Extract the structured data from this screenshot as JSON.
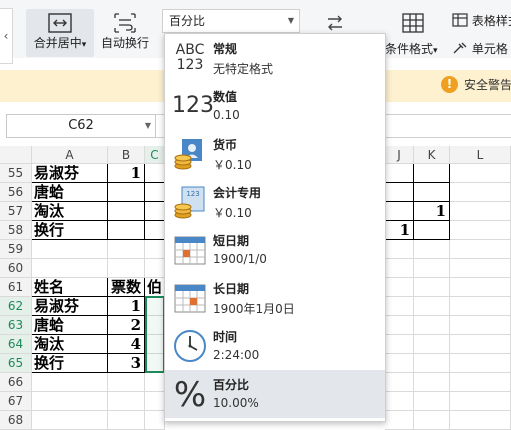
{
  "toolbar": {
    "merge_center": "合并居中",
    "merge_arrow": "▾",
    "auto_wrap": "自动换行",
    "number_format_value": "百分比",
    "cond_format": "条件格式",
    "cond_arrow": "▾",
    "table_style": "表格样式",
    "cell": "单元格"
  },
  "warning": {
    "text": "安全警告"
  },
  "name_box": {
    "value": "C62"
  },
  "columns": [
    "A",
    "B",
    "C",
    "J",
    "K",
    "L"
  ],
  "rows": [
    {
      "num": "55",
      "a": "易淑芬",
      "b": "1",
      "j": "",
      "k": ""
    },
    {
      "num": "56",
      "a": "唐蛤",
      "b": "",
      "j": "",
      "k": ""
    },
    {
      "num": "57",
      "a": "淘汰",
      "b": "",
      "j": "",
      "k": "1"
    },
    {
      "num": "58",
      "a": "换行",
      "b": "",
      "j": "1",
      "k": ""
    },
    {
      "num": "59",
      "a": "",
      "b": "",
      "j": "",
      "k": ""
    },
    {
      "num": "60",
      "a": "",
      "b": "",
      "j": "",
      "k": ""
    },
    {
      "num": "61",
      "a": "姓名",
      "b": "票数",
      "c": "伯",
      "j": "",
      "k": ""
    },
    {
      "num": "62",
      "a": "易淑芬",
      "b": "1",
      "j": "",
      "k": ""
    },
    {
      "num": "63",
      "a": "唐蛤",
      "b": "2",
      "j": "",
      "k": ""
    },
    {
      "num": "64",
      "a": "淘汰",
      "b": "4",
      "j": "",
      "k": ""
    },
    {
      "num": "65",
      "a": "换行",
      "b": "3",
      "j": "",
      "k": ""
    },
    {
      "num": "66",
      "a": "",
      "b": "",
      "j": "",
      "k": ""
    },
    {
      "num": "67",
      "a": "",
      "b": "",
      "j": "",
      "k": ""
    },
    {
      "num": "68",
      "a": "",
      "b": "",
      "j": "",
      "k": ""
    }
  ],
  "format_menu": {
    "items": [
      {
        "icon": "abc-123-icon",
        "title": "常规",
        "example": "无特定格式"
      },
      {
        "icon": "number-123-icon",
        "title": "数值",
        "example": "0.10"
      },
      {
        "icon": "currency-icon",
        "title": "货币",
        "example": "￥0.10"
      },
      {
        "icon": "accounting-icon",
        "title": "会计专用",
        "example": " ￥0.10"
      },
      {
        "icon": "short-date-icon",
        "title": "短日期",
        "example": "1900/1/0"
      },
      {
        "icon": "long-date-icon",
        "title": "长日期",
        "example": "1900年1月0日"
      },
      {
        "icon": "clock-icon",
        "title": "时间",
        "example": "2:24:00"
      },
      {
        "icon": "percent-icon",
        "title": "百分比",
        "example": "10.00%"
      }
    ],
    "icon_texts": {
      "abc": "ABC",
      "n123": "123",
      "small123": "123",
      "percent": "%"
    },
    "selected": "百分比"
  },
  "colors": {
    "accent_green": "#1e8a5c",
    "warning_bg": "#fdf1d0",
    "menu_selected_bg": "#e3e6ea"
  }
}
